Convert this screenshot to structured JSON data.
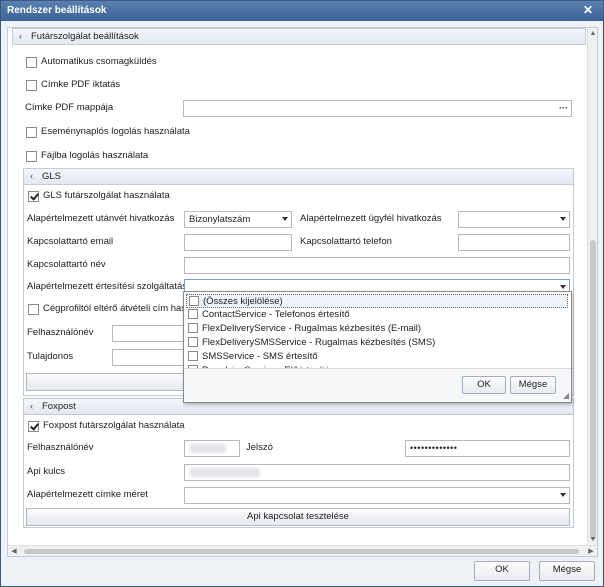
{
  "window": {
    "title": "Rendszer beállítások"
  },
  "courier_group": {
    "title": "Futárszolgálat beállítások",
    "auto_send_label": "Automatikus csomagküldés",
    "pdf_archive_label": "Címke PDF iktatás",
    "pdf_folder_label": "Címke PDF mappája",
    "pdf_folder_value": "",
    "event_log_label": "Eseménynaplós logolás használata",
    "file_log_label": "Fájlba logolás használata"
  },
  "gls": {
    "title": "GLS",
    "use_label": "GLS futárszolgálat használata",
    "cod_ref_label": "Alapértelmezett utánvét hivatkozás",
    "cod_ref_value": "Bizonylatszám",
    "client_ref_label": "Alapértelmezett ügyfél hivatkozás",
    "client_ref_value": "",
    "contact_email_label": "Kapcsolattartó email",
    "contact_email_value": "",
    "contact_phone_label": "Kapcsolattartó telefon",
    "contact_phone_value": "",
    "contact_name_label": "Kapcsolattartó név",
    "contact_name_value": "",
    "notify_label": "Alapértelmezett értesítési szolgáltatások",
    "notify_value": "",
    "company_profile_label": "Cégprofiltól eltérő átvételi cím haszná",
    "username_label": "Felhasználónév",
    "owner_label": "Tulajdonos"
  },
  "notify_popup": {
    "options": [
      "(Összes kijelölése)",
      "ContactService - Telefonos értesítő",
      "FlexDeliveryService - Rugalmas kézbesítés (E-mail)",
      "FlexDeliverySMSService - Rugalmas kézbesítés (SMS)",
      "SMSService - SMS értesítő",
      "PreadviceService - Előértesítés"
    ],
    "ok_label": "OK",
    "cancel_label": "Mégse"
  },
  "foxpost": {
    "title": "Foxpost",
    "use_label": "Foxpost futárszolgálat használata",
    "username_label": "Felhasználónév",
    "password_label": "Jelszó",
    "password_value": "•••••••••••••",
    "api_key_label": "Api kulcs",
    "label_size_label": "Alapértelmezett címke méret",
    "label_size_value": "",
    "test_button_label": "Api kapcsolat tesztelése"
  },
  "footer": {
    "ok_label": "OK",
    "cancel_label": "Mégse"
  },
  "icons": {
    "close": "close-icon",
    "collapse": "chevron-left-icon",
    "dropdown": "chevron-down-icon",
    "browse": "ellipsis-icon",
    "resize": "resize-grip-icon"
  }
}
